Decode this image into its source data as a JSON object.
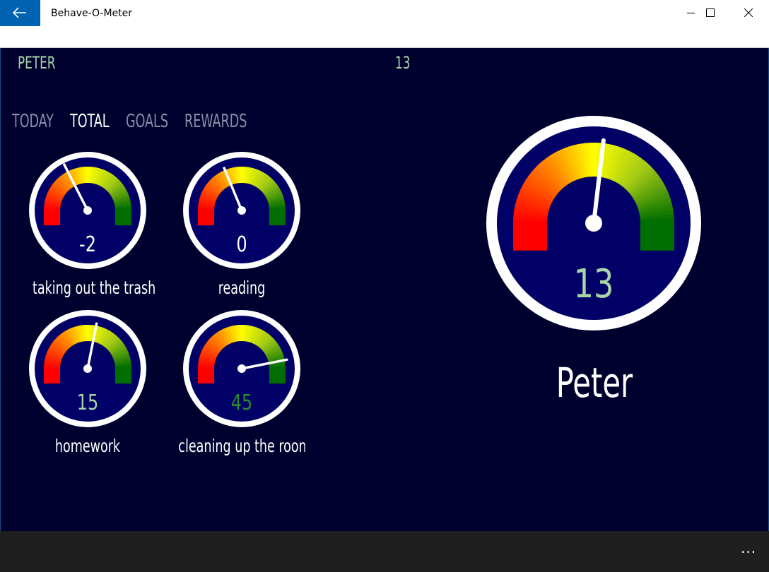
{
  "window": {
    "title": "Behave-O-Meter"
  },
  "header": {
    "name": "PETER",
    "score": "13"
  },
  "tabs": [
    {
      "label": "TODAY",
      "active": false
    },
    {
      "label": "TOTAL",
      "active": true
    },
    {
      "label": "GOALS",
      "active": false
    },
    {
      "label": "REWARDS",
      "active": false
    }
  ],
  "gauges": [
    {
      "label": "taking out the trash",
      "value": "-2",
      "value_color": "#ffffff"
    },
    {
      "label": "reading",
      "value": "0",
      "value_color": "#ffffff"
    },
    {
      "label": "homework",
      "value": "15",
      "value_color": "#a8d5a8"
    },
    {
      "label": "cleaning up the room",
      "value": "45",
      "value_color": "#2e8b2e"
    }
  ],
  "big_gauge": {
    "value": "13",
    "name": "Peter",
    "value_color": "#a8d5a8"
  },
  "bottombar": {
    "more": "..."
  },
  "colors": {
    "accent": "#0063b1",
    "background": "#00002e",
    "dial": "#000066"
  }
}
